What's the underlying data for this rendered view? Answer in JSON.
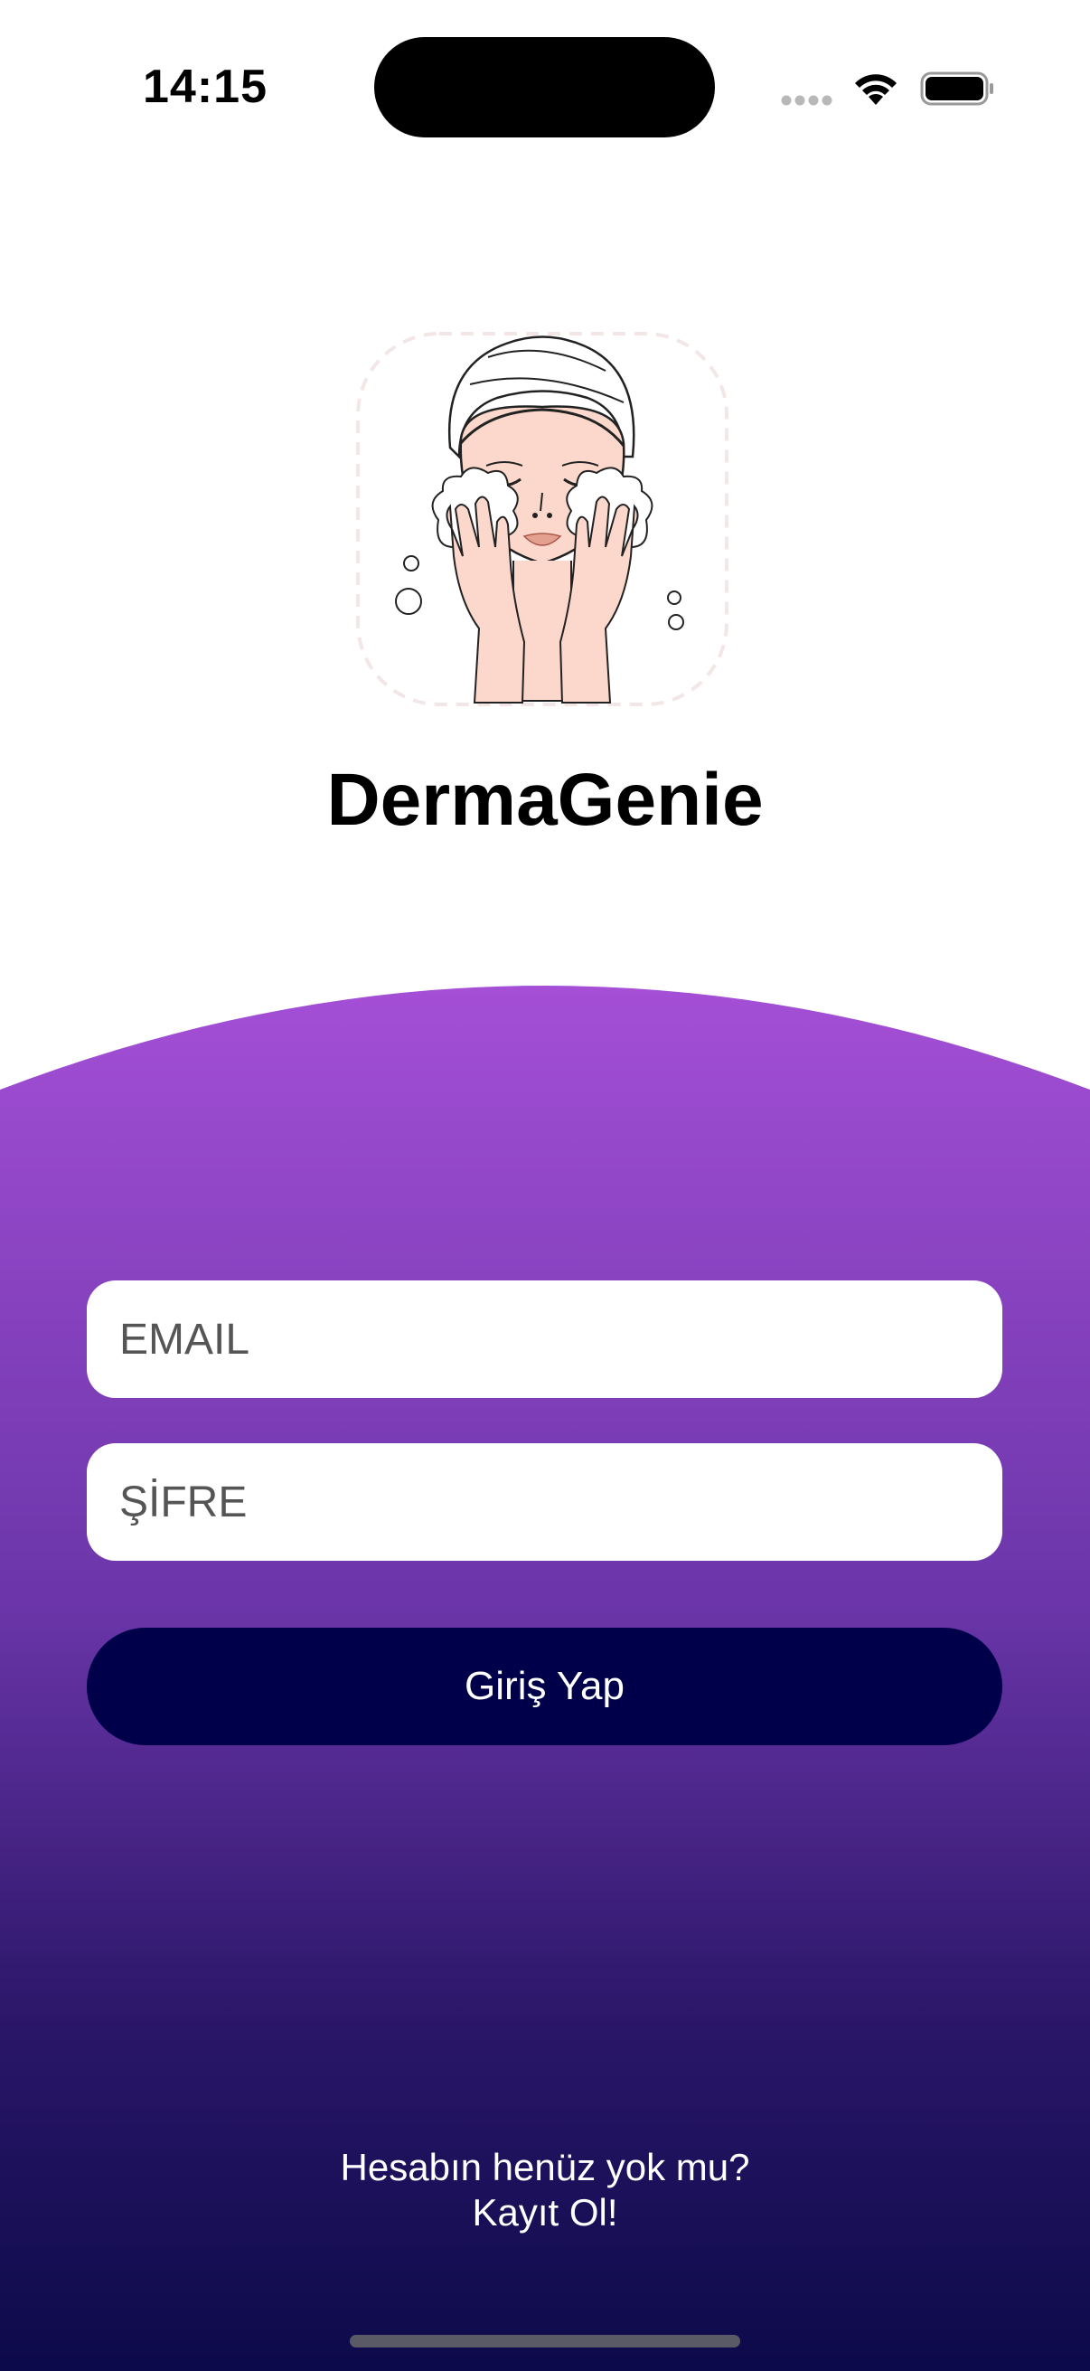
{
  "status_bar": {
    "time": "14:15"
  },
  "app": {
    "title": "DermaGenie",
    "logo_icon": "face-washing-woman-icon"
  },
  "login_form": {
    "email_placeholder": "EMAIL",
    "password_placeholder": "ŞİFRE",
    "login_label": "Giriş Yap"
  },
  "signup": {
    "question": "Hesabın henüz yok mu?",
    "link": "Kayıt Ol!"
  },
  "colors": {
    "gradient_top": "#a44fd6",
    "gradient_mid": "#6a35a8",
    "gradient_bottom": "#0c0a4a",
    "button": "#00004a",
    "background": "#ffffff"
  }
}
